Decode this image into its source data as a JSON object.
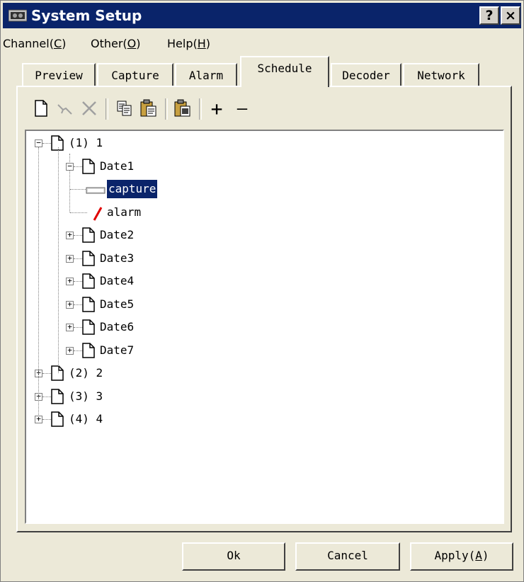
{
  "window": {
    "title": "System Setup",
    "help_glyph": "?",
    "close_glyph": "×",
    "title_bar_color": "#0a246a",
    "selection_color": "#0a246a"
  },
  "menu": [
    {
      "pre": "Channel(",
      "key": "C",
      "post": ")"
    },
    {
      "pre": "Other(",
      "key": "O",
      "post": ")"
    },
    {
      "pre": "Help(",
      "key": "H",
      "post": ")"
    }
  ],
  "tabs": [
    {
      "label": "Preview",
      "active": false
    },
    {
      "label": "Capture",
      "active": false
    },
    {
      "label": "Alarm",
      "active": false
    },
    {
      "label": "Schedule",
      "active": true
    },
    {
      "label": "Decoder",
      "active": false
    },
    {
      "label": "Network",
      "active": false
    }
  ],
  "toolbar": {
    "icons": [
      "new-icon",
      "edit-icon",
      "delete-icon",
      "copy-icon",
      "paste-icon",
      "paste-special-icon",
      "plus-icon",
      "minus-icon"
    ],
    "plus_glyph": "+",
    "minus_glyph": "—"
  },
  "tree": {
    "channels": [
      {
        "label": "(1) 1",
        "expanded": true
      },
      {
        "label": "(2) 2",
        "expanded": false
      },
      {
        "label": "(3) 3",
        "expanded": false
      },
      {
        "label": "(4) 4",
        "expanded": false
      }
    ],
    "dates": [
      {
        "label": "Date1",
        "expanded": true
      },
      {
        "label": "Date2",
        "expanded": false
      },
      {
        "label": "Date3",
        "expanded": false
      },
      {
        "label": "Date4",
        "expanded": false
      },
      {
        "label": "Date5",
        "expanded": false
      },
      {
        "label": "Date6",
        "expanded": false
      },
      {
        "label": "Date7",
        "expanded": false
      }
    ],
    "entries": [
      {
        "label": "capture",
        "icon": "capture-icon",
        "selected": true
      },
      {
        "label": "alarm",
        "icon": "alarm-icon",
        "selected": false
      }
    ],
    "expand_glyph": "+",
    "collapse_glyph": "−"
  },
  "buttons": {
    "ok": "Ok",
    "cancel": "Cancel",
    "apply_pre": "Apply(",
    "apply_key": "A",
    "apply_post": ")"
  }
}
